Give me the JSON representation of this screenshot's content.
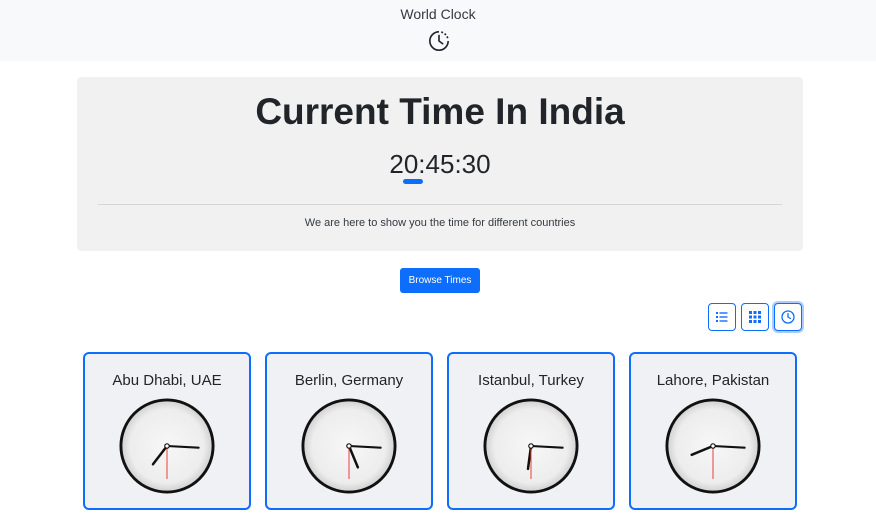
{
  "header": {
    "title": "World Clock",
    "logo_icon": "clock-dashed-icon"
  },
  "hero": {
    "heading": "Current Time In India",
    "time": "20:45:30",
    "lead": "We are here to show you the time for different countries"
  },
  "browse_button": "Browse Times",
  "view_toggles": [
    {
      "icon": "list-icon",
      "active": false
    },
    {
      "icon": "grid-icon",
      "active": false
    },
    {
      "icon": "clock-icon",
      "active": true
    }
  ],
  "cities": [
    {
      "name": "Abu Dhabi, UAE",
      "time": "19:15:30"
    },
    {
      "name": "Berlin, Germany",
      "time": "17:15:30"
    },
    {
      "name": "Istanbul, Turkey",
      "time": "18:15:30"
    },
    {
      "name": "Lahore, Pakistan",
      "time": "20:15:30"
    }
  ],
  "colors": {
    "accent": "#0d6efd",
    "second_hand": "#e53935",
    "card_bg": "#f0f1f5"
  }
}
